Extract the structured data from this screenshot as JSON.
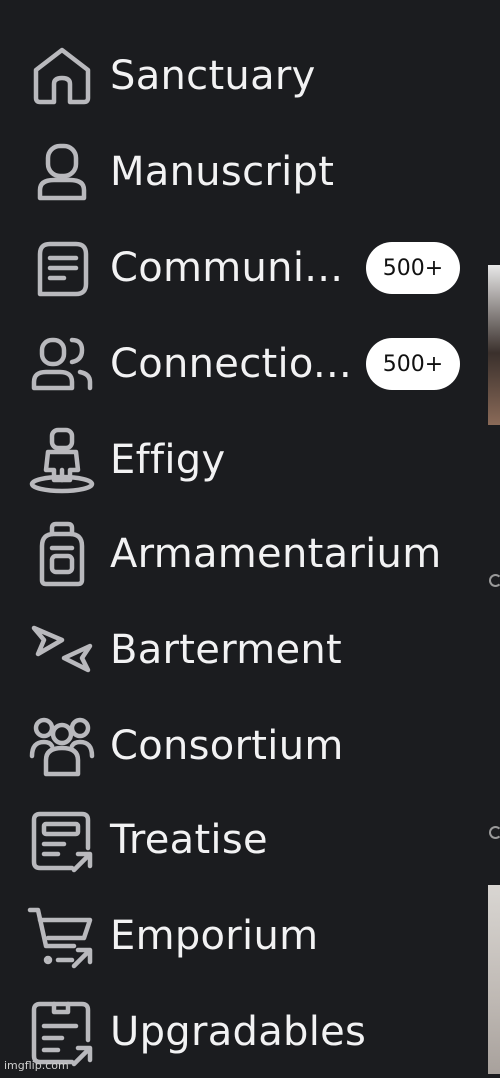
{
  "sidebar": {
    "items": [
      {
        "label": "Sanctuary",
        "icon": "home-icon"
      },
      {
        "label": "Manuscript",
        "icon": "profile-icon"
      },
      {
        "label": "Communi...",
        "icon": "messages-icon",
        "badge": "500+"
      },
      {
        "label": "Connectio...",
        "icon": "friends-icon",
        "badge": "500+"
      },
      {
        "label": "Effigy",
        "icon": "avatar-icon"
      },
      {
        "label": "Armamentarium",
        "icon": "backpack-icon"
      },
      {
        "label": "Barterment",
        "icon": "trade-icon"
      },
      {
        "label": "Consortium",
        "icon": "groups-icon"
      },
      {
        "label": "Treatise",
        "icon": "blog-icon"
      },
      {
        "label": "Emporium",
        "icon": "cart-icon"
      },
      {
        "label": "Upgradables",
        "icon": "upgrades-icon"
      }
    ]
  },
  "watermark": "imgflip.com",
  "colors": {
    "background": "#1b1c1f",
    "text": "#f2f2f3",
    "icon": "#b9b9bd",
    "badge_bg": "#ffffff"
  }
}
